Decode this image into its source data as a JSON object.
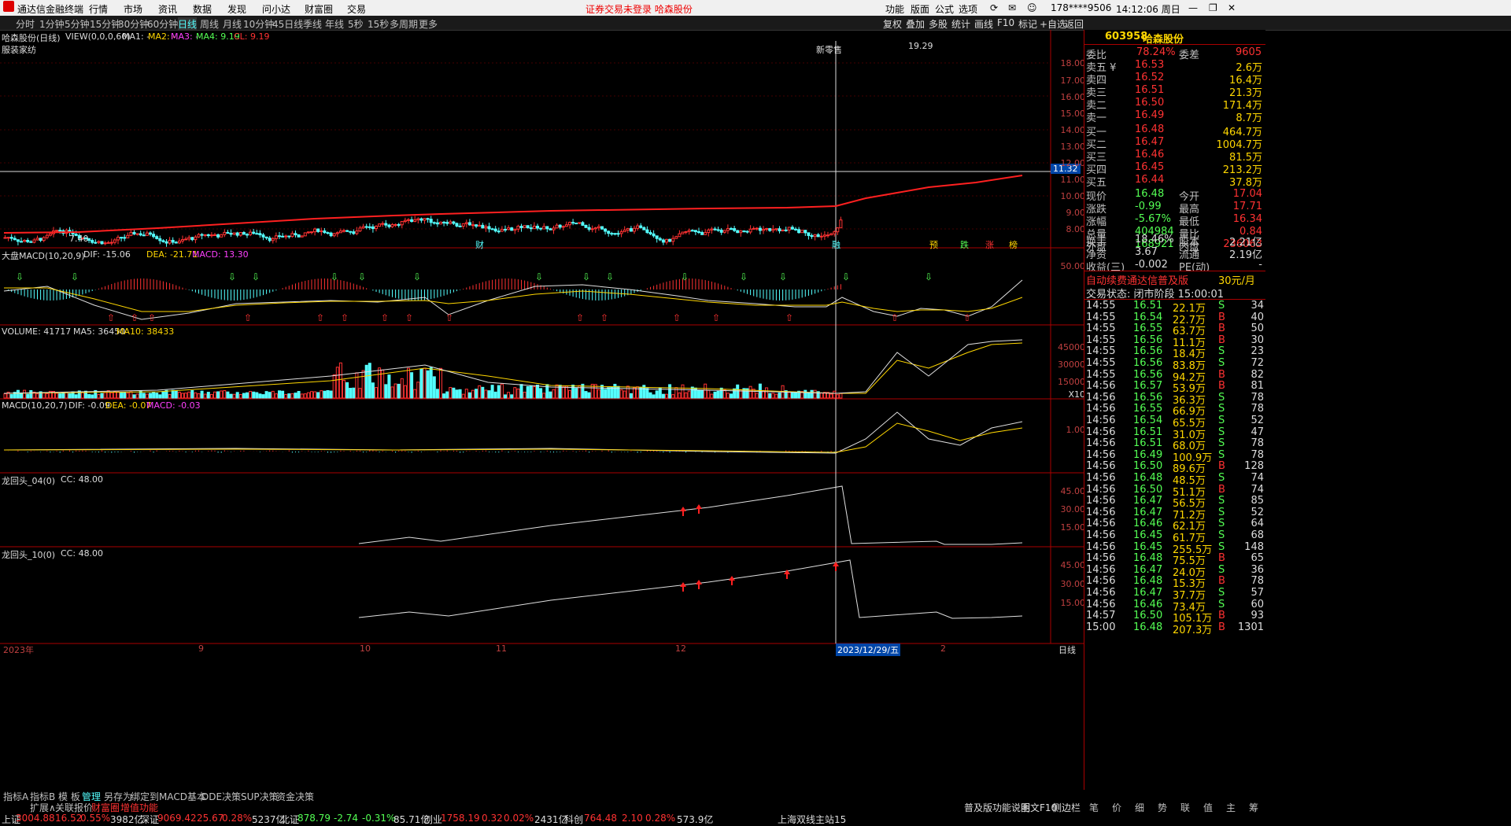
{
  "window": {
    "app_title": "通达信金融终端",
    "menus": [
      "行情",
      "市场",
      "资讯",
      "数据",
      "发现",
      "问小达",
      "财富圈",
      "交易"
    ],
    "notice": "证券交易未登录  哈森股份",
    "right_menus": [
      "功能",
      "版面",
      "公式",
      "选项"
    ],
    "account": "178****9506",
    "clock": "14:12:06 周日"
  },
  "periods": [
    "分时",
    "1分钟",
    "5分钟",
    "15分钟",
    "30分钟",
    "60分钟",
    "日线",
    "周线",
    "月线",
    "10分钟",
    "45日线",
    "季线",
    "年线",
    "5秒",
    "15秒",
    "多周期",
    "更多"
  ],
  "active_period": "日线",
  "tool_buttons": [
    "复权",
    "叠加",
    "多股",
    "统计",
    "画线",
    "F10",
    "标记",
    "+自选",
    "返回"
  ],
  "kline": {
    "header_name": "哈森股份(日线)",
    "view": "VIEW(0,0,0,60)",
    "ma1": "MA1: -",
    "ma2": "MA2: -",
    "ma3": "MA3: -",
    "ma4": "MA4: 9.19",
    "cl": "CL: 9.19",
    "sector": "服装家纺",
    "annotation": "新零售",
    "high_label": "19.29",
    "low_label": "7.40",
    "cursor_price": "11.32",
    "y_ticks": [
      "18.00",
      "17.00",
      "16.00",
      "15.00",
      "14.00",
      "13.00",
      "12.00",
      "11.00",
      "10.00",
      "9.00",
      "8.00"
    ],
    "markers": [
      "财",
      "融",
      "预",
      "跌",
      "涨",
      "榜"
    ]
  },
  "panel_macd_big": {
    "title": "大盘MACD(10,20,9)",
    "dif": "DIF: -15.06",
    "dea": "DEA: -21.71",
    "macd": "MACD: 13.30",
    "y_tick": "50.00"
  },
  "panel_volume": {
    "title": "VOLUME: 41717",
    "ma5": "MA5: 36450",
    "ma10": "MA10: 38433",
    "y_ticks": [
      "45000",
      "30000",
      "15000"
    ],
    "unit": "X10"
  },
  "panel_macd": {
    "title": "MACD(10,20,7)",
    "dif": "DIF: -0.09",
    "dea": "DEA: -0.07",
    "macd": "MACD: -0.03",
    "y_tick": "1.00"
  },
  "panel_dragon04": {
    "title": "龙回头_04(0)",
    "cc": "CC: 48.00",
    "y_ticks": [
      "45.00",
      "30.00",
      "15.00"
    ]
  },
  "panel_dragon10": {
    "title": "龙回头_10(0)",
    "cc": "CC: 48.00",
    "y_ticks": [
      "45.00",
      "30.00",
      "15.00"
    ]
  },
  "date_axis": {
    "labels": [
      "2023年",
      "9",
      "10",
      "11",
      "12",
      "2023/12/29/五",
      "2"
    ],
    "period_label": "日线"
  },
  "sidebar": {
    "code": "603958",
    "name": "哈森股份",
    "weibi_label": "委比",
    "weibi": "78.24%",
    "weicha_label": "委差",
    "weicha": "9605",
    "asks": [
      {
        "label": "卖五 ¥",
        "price": "16.53",
        "vol": "2.6万"
      },
      {
        "label": "卖四",
        "price": "16.52",
        "vol": "16.4万"
      },
      {
        "label": "卖三",
        "price": "16.51",
        "vol": "21.3万"
      },
      {
        "label": "卖二",
        "price": "16.50",
        "vol": "171.4万"
      },
      {
        "label": "卖一",
        "price": "16.49",
        "vol": "8.7万"
      }
    ],
    "bids": [
      {
        "label": "买一",
        "price": "16.48",
        "vol": "464.7万"
      },
      {
        "label": "买二",
        "price": "16.47",
        "vol": "1004.7万"
      },
      {
        "label": "买三",
        "price": "16.46",
        "vol": "81.5万"
      },
      {
        "label": "买四",
        "price": "16.45",
        "vol": "213.2万"
      },
      {
        "label": "买五",
        "price": "16.44",
        "vol": "37.8万"
      }
    ],
    "stats": [
      {
        "l1": "现价",
        "v1": "16.48",
        "l2": "今开",
        "v2": "17.04"
      },
      {
        "l1": "涨跌",
        "v1": "-0.99",
        "l2": "最高",
        "v2": "17.71"
      },
      {
        "l1": "涨幅",
        "v1": "-5.67%",
        "l2": "最低",
        "v2": "16.34"
      },
      {
        "l1": "总量",
        "v1": "404984",
        "l2": "量比",
        "v2": "0.84"
      },
      {
        "l1": "外盘",
        "v1": "168921",
        "l2": "内盘",
        "v2": "236063"
      }
    ],
    "stats2": [
      {
        "l1": "换手",
        "v1": "18.46%",
        "l2": "股本",
        "v2": "2.21亿"
      },
      {
        "l1": "净资",
        "v1": "3.67",
        "l2": "流通",
        "v2": "2.19亿"
      },
      {
        "l1": "收益(三)",
        "v1": "-0.002",
        "l2": "PE(动)",
        "v2": "-"
      }
    ],
    "ad": "自动续费通达信普及版",
    "ad_price": "30元/月",
    "trade_status": "交易状态: 闭市阶段 15:00:01",
    "ticks": [
      [
        "14:55",
        "16.51",
        "22.1万",
        "S",
        "34"
      ],
      [
        "14:55",
        "16.54",
        "22.7万",
        "B",
        "40"
      ],
      [
        "14:55",
        "16.55",
        "63.7万",
        "B",
        "50"
      ],
      [
        "14:55",
        "16.56",
        "11.1万",
        "B",
        "30"
      ],
      [
        "14:55",
        "16.56",
        "18.4万",
        "S",
        "23"
      ],
      [
        "14:55",
        "16.56",
        "83.8万",
        "S",
        "72"
      ],
      [
        "14:55",
        "16.56",
        "94.2万",
        "B",
        "82"
      ],
      [
        "14:56",
        "16.57",
        "53.9万",
        "B",
        "81"
      ],
      [
        "14:56",
        "16.56",
        "36.3万",
        "S",
        "78"
      ],
      [
        "14:56",
        "16.55",
        "66.9万",
        "S",
        "78"
      ],
      [
        "14:56",
        "16.54",
        "65.5万",
        "S",
        "52"
      ],
      [
        "14:56",
        "16.51",
        "31.0万",
        "S",
        "47"
      ],
      [
        "14:56",
        "16.51",
        "68.0万",
        "S",
        "78"
      ],
      [
        "14:56",
        "16.49",
        "100.9万",
        "S",
        "78"
      ],
      [
        "14:56",
        "16.50",
        "89.6万",
        "B",
        "128"
      ],
      [
        "14:56",
        "16.48",
        "48.5万",
        "S",
        "74"
      ],
      [
        "14:56",
        "16.50",
        "51.1万",
        "B",
        "74"
      ],
      [
        "14:56",
        "16.47",
        "56.5万",
        "S",
        "85"
      ],
      [
        "14:56",
        "16.47",
        "71.2万",
        "S",
        "52"
      ],
      [
        "14:56",
        "16.46",
        "62.1万",
        "S",
        "64"
      ],
      [
        "14:56",
        "16.45",
        "61.7万",
        "S",
        "68"
      ],
      [
        "14:56",
        "16.45",
        "255.5万",
        "S",
        "148"
      ],
      [
        "14:56",
        "16.48",
        "75.5万",
        "B",
        "65"
      ],
      [
        "14:56",
        "16.47",
        "24.0万",
        "S",
        "36"
      ],
      [
        "14:56",
        "16.48",
        "15.3万",
        "B",
        "78"
      ],
      [
        "14:56",
        "16.47",
        "37.7万",
        "S",
        "57"
      ],
      [
        "14:56",
        "16.46",
        "73.4万",
        "S",
        "60"
      ],
      [
        "14:57",
        "16.50",
        "105.1万",
        "B",
        "93"
      ],
      [
        "15:00",
        "16.48",
        "207.3万",
        "B",
        "1301"
      ]
    ],
    "tabs": [
      "笔",
      "价",
      "细",
      "势",
      "联",
      "值",
      "主",
      "筹"
    ]
  },
  "bottom_tabs": [
    "指标A",
    "指标B",
    "模 板",
    "管理",
    "另存为",
    "绑定到",
    "MACD基本",
    "DDE决策",
    "SUP决策",
    "资金决策"
  ],
  "bottom_tabs2": [
    "扩展∧",
    "关联报价",
    "财富圈",
    "增值功能"
  ],
  "bottom_right": [
    "普及版功能说明",
    "图文F10",
    "侧边栏"
  ],
  "status_bar": {
    "sh_label": "上证",
    "sh": "3004.88",
    "sh_chg": "16.52",
    "sh_pct": "0.55%",
    "sh_amt": "3982亿",
    "sz_label": "深证",
    "sz": "9069.42",
    "sz_chg": "25.67",
    "sz_pct": "0.28%",
    "sz_amt": "5237亿",
    "bz_label": "北证",
    "bz": "878.79",
    "bz_chg": "-2.74",
    "bz_pct": "-0.31%",
    "bz_amt": "85.71亿",
    "cy_label": "创业",
    "cy": "1758.19",
    "cy_chg": "0.32",
    "cy_pct": "0.02%",
    "cy_amt": "2431亿",
    "kc_label": "科创",
    "kc": "764.48",
    "kc_chg": "2.10",
    "kc_pct": "0.28%",
    "kc_amt": "573.9亿",
    "station": "上海双线主站15"
  },
  "colors": {
    "up": "#ff3232",
    "down": "#54ffff",
    "ma": "#ffff54",
    "accent": "#ff0000"
  }
}
